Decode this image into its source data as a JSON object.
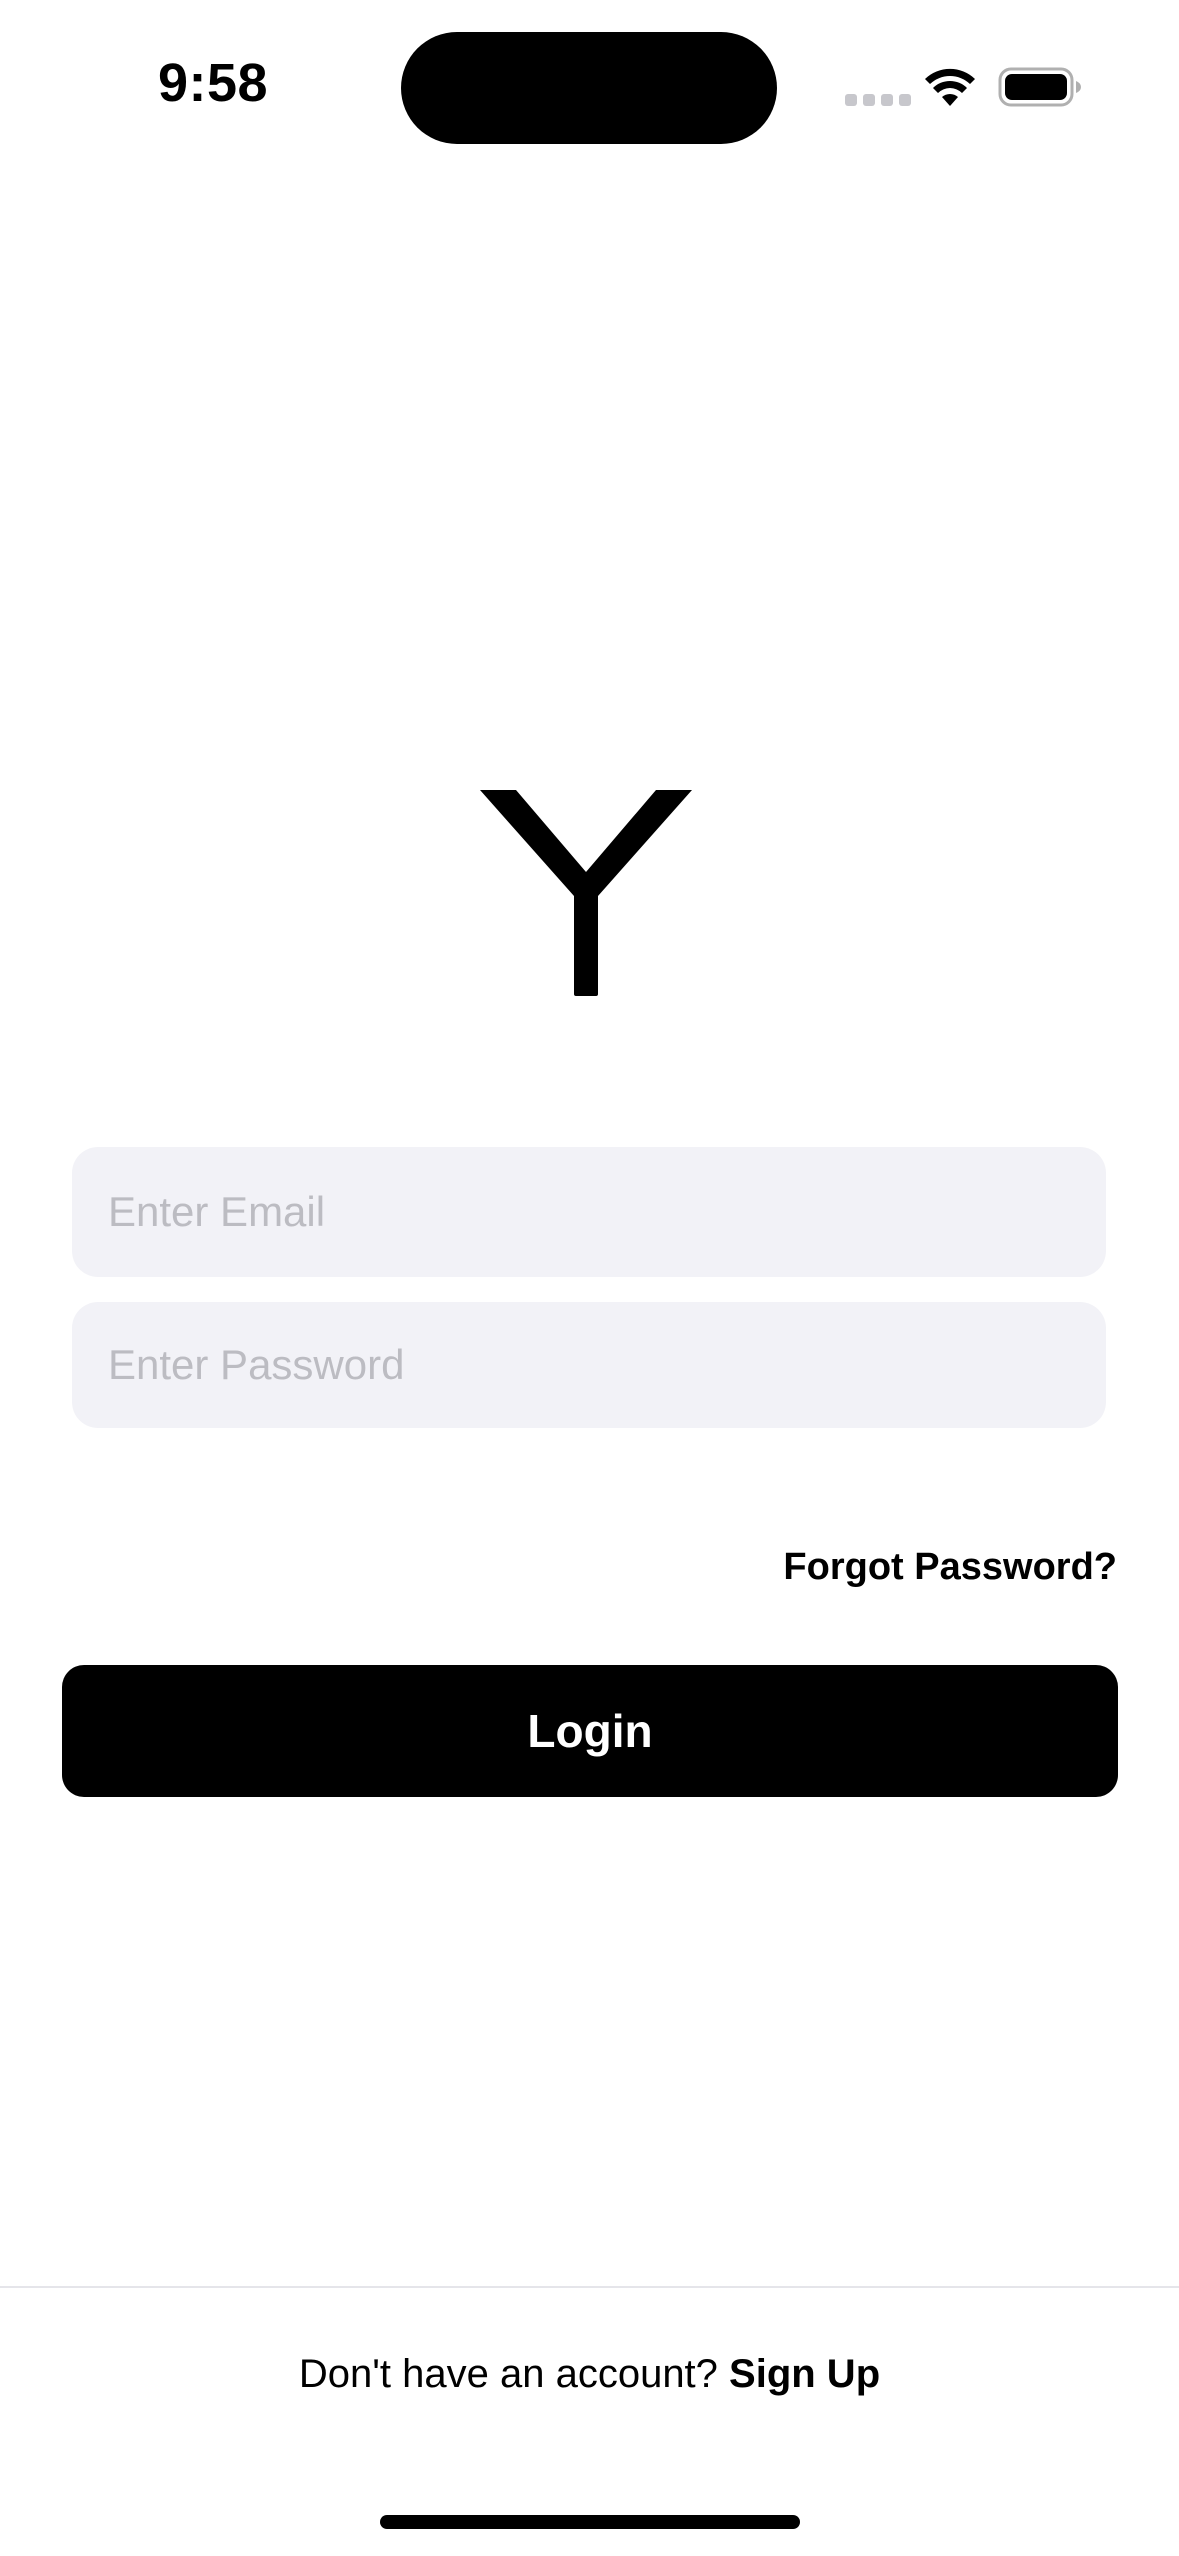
{
  "status_bar": {
    "time": "9:58"
  },
  "icons": {
    "wifi": "wifi-icon",
    "battery": "battery-icon",
    "logo": "y-logo-icon"
  },
  "login_form": {
    "email_placeholder": "Enter Email",
    "email_value": "",
    "password_placeholder": "Enter Password",
    "password_value": "",
    "forgot_password_label": "Forgot Password?",
    "login_label": "Login"
  },
  "footer": {
    "prompt_text": "Don't have an account? ",
    "signup_label": "Sign Up"
  },
  "colors": {
    "field_background": "#f2f2f7",
    "placeholder": "#bcbcc2",
    "button_background": "#000000",
    "button_text": "#ffffff"
  }
}
